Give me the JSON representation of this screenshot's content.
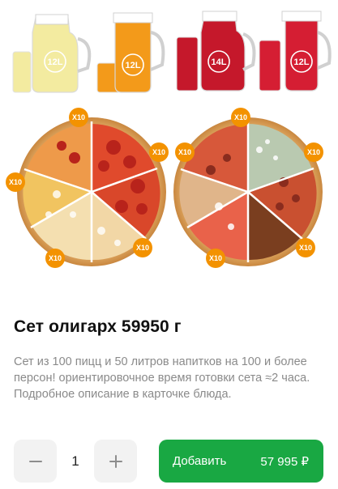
{
  "product": {
    "title": "Сет олигарх 59950 г",
    "description": "Сет из 100 пицц и 50 литров напитков на 100 и более персон! ориентировочное время готовки сета ≈2 часа. Подробное описание в карточке блюда."
  },
  "image": {
    "jugs": [
      {
        "label": "12L",
        "drink": "lemonade",
        "color": "#f3eba0"
      },
      {
        "label": "12L",
        "drink": "orange-juice",
        "color": "#f39a1a"
      },
      {
        "label": "14L",
        "drink": "berry-juice",
        "color": "#c5182b"
      },
      {
        "label": "12L",
        "drink": "cherry-juice",
        "color": "#d51e33"
      }
    ],
    "badges": [
      "X10",
      "X10",
      "X10",
      "X10",
      "X10",
      "X10",
      "X10",
      "X10",
      "X10",
      "X10"
    ],
    "badge_color": "#f39200"
  },
  "cart": {
    "quantity": "1",
    "add_label": "Добавить",
    "price": "57 995 ₽",
    "accent": "#19a843"
  }
}
